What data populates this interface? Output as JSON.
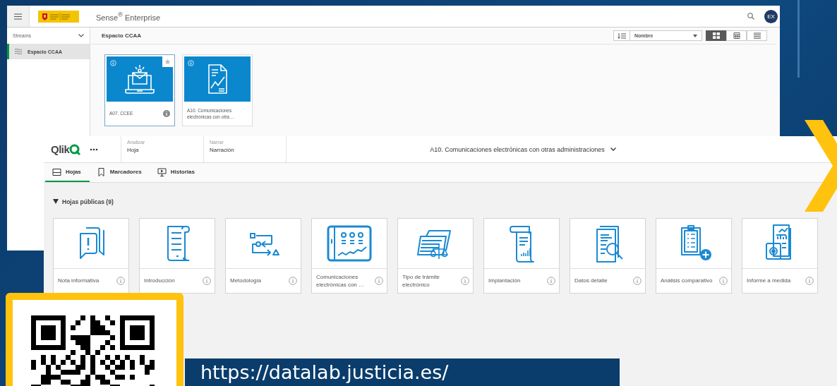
{
  "hub": {
    "brand": "Sense$^{®}$ Enterprise",
    "avatar": "EX",
    "sidebar": {
      "heading": "Streams",
      "items": [
        {
          "label": "Espacio CCAA",
          "selected": true
        }
      ]
    },
    "stream_title": "Espacio CCAA",
    "sort": {
      "value": "Nombre"
    },
    "view_modes": [
      {
        "kind": "grid",
        "selected": true
      },
      {
        "kind": "table",
        "selected": false
      },
      {
        "kind": "list",
        "selected": false
      }
    ],
    "apps": [
      {
        "title": "A07. CCEE",
        "kind": "laptop-mail",
        "hovered": true
      },
      {
        "title": "A10. Comunicaciones electrónicas con otra…",
        "kind": "document-chart",
        "hovered": false
      }
    ]
  },
  "app": {
    "logo": "Qlik",
    "modes": [
      {
        "label": "Analizar",
        "value": "Hoja"
      },
      {
        "label": "Narrar",
        "value": "Narración"
      }
    ],
    "title": "A10. Comunicaciones electrónicas con otras administraciones",
    "tabs": [
      {
        "label": "Hojas",
        "kind": "sheet",
        "selected": true
      },
      {
        "label": "Marcadores",
        "kind": "bookmark",
        "selected": false
      },
      {
        "label": "Historias",
        "kind": "story",
        "selected": false
      }
    ],
    "section": {
      "title": "Hojas públicas (9)",
      "expanded": true
    },
    "sheets": [
      {
        "title": "Nota informativa",
        "kind": "alert"
      },
      {
        "title": "Introducción",
        "kind": "scroll"
      },
      {
        "title": "Metodología",
        "kind": "flow"
      },
      {
        "title": "Comunicaciones electrónicas con …",
        "kind": "dashboard"
      },
      {
        "title": "Tipo de trámite electrónico",
        "kind": "scales"
      },
      {
        "title": "Implantación",
        "kind": "scroll-chart"
      },
      {
        "title": "Datos detalle",
        "kind": "magnifier"
      },
      {
        "title": "Análisis comparativo",
        "kind": "clipboard"
      },
      {
        "title": "Informe a medida",
        "kind": "report"
      }
    ]
  },
  "link": {
    "url": "https://datalab.justicia.es/"
  }
}
